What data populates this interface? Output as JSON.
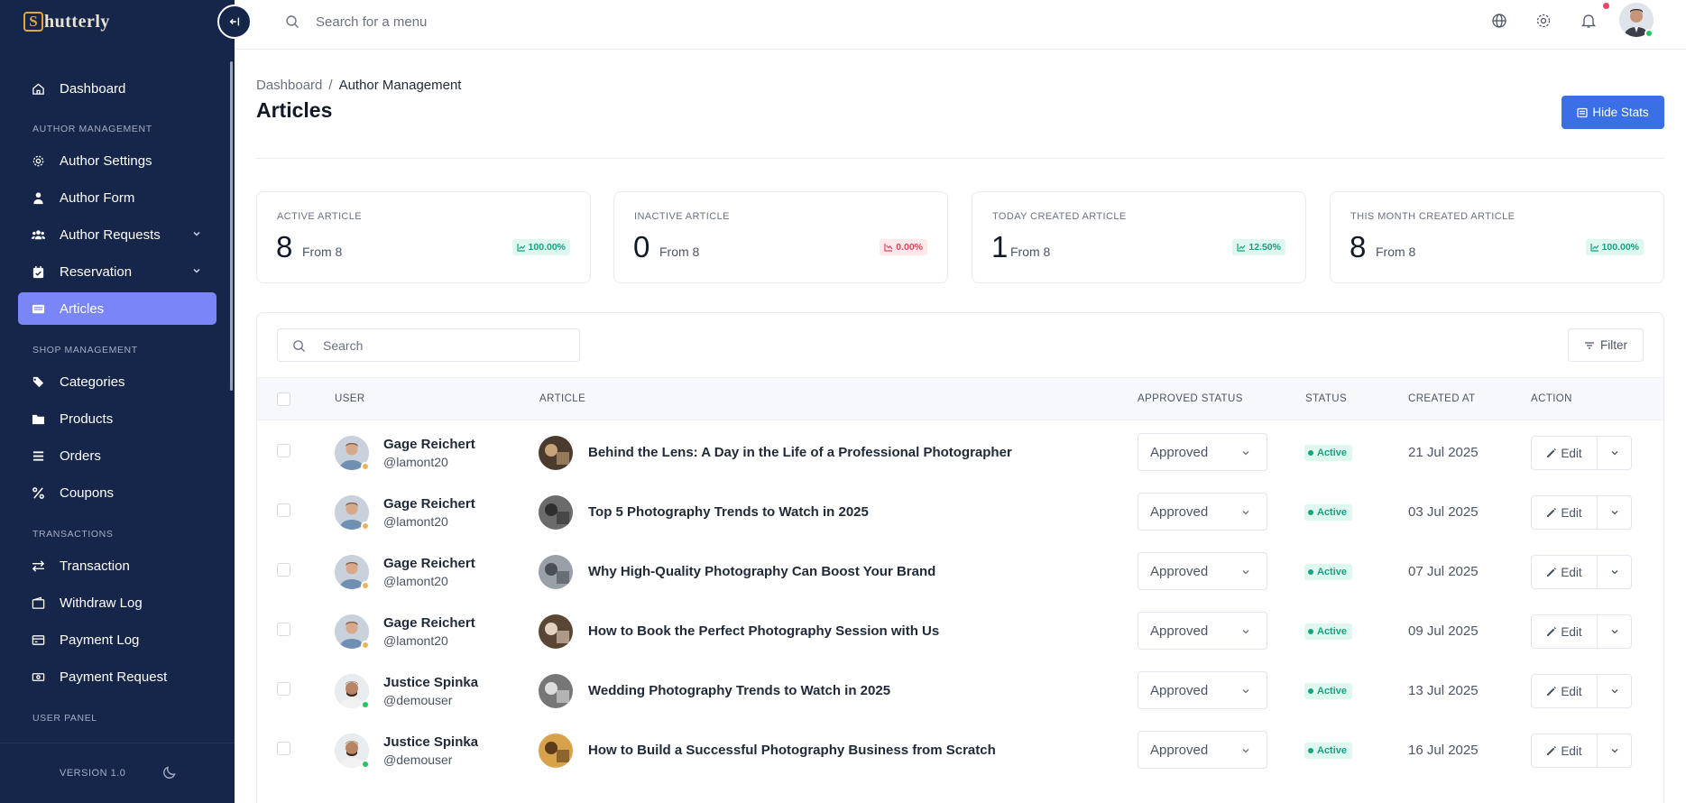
{
  "brand": {
    "logo_letter": "S",
    "logo_text": "hutterly"
  },
  "sidebar": {
    "items": [
      {
        "label": "Dashboard",
        "icon": "home-icon"
      },
      {
        "label": "Author Settings",
        "icon": "gear-icon"
      },
      {
        "label": "Author Form",
        "icon": "user-icon"
      },
      {
        "label": "Author Requests",
        "icon": "users-icon",
        "expandable": true
      },
      {
        "label": "Reservation",
        "icon": "calendar-check-icon",
        "expandable": true
      },
      {
        "label": "Articles",
        "icon": "article-icon",
        "active": true
      },
      {
        "label": "Categories",
        "icon": "tags-icon"
      },
      {
        "label": "Products",
        "icon": "folder-icon"
      },
      {
        "label": "Orders",
        "icon": "list-icon"
      },
      {
        "label": "Coupons",
        "icon": "percent-icon"
      },
      {
        "label": "Transaction",
        "icon": "arrows-exchange-icon"
      },
      {
        "label": "Withdraw Log",
        "icon": "wallet-icon"
      },
      {
        "label": "Payment Log",
        "icon": "credit-card-icon"
      },
      {
        "label": "Payment Request",
        "icon": "money-icon"
      }
    ],
    "sections": [
      "AUTHOR MANAGEMENT",
      "SHOP MANAGEMENT",
      "TRANSACTIONS",
      "USER PANEL"
    ],
    "version": "VERSION 1.0"
  },
  "topbar": {
    "search_placeholder": "Search for a menu"
  },
  "breadcrumb": {
    "root": "Dashboard",
    "separator": "/",
    "current": "Author Management"
  },
  "page": {
    "title": "Articles",
    "hide_stats_label": "Hide Stats"
  },
  "stats": [
    {
      "label": "ACTIVE ARTICLE",
      "value": "8",
      "from": "From 8",
      "change": "100.00%",
      "trend": "up"
    },
    {
      "label": "INACTIVE ARTICLE",
      "value": "0",
      "from": "From 8",
      "change": "0.00%",
      "trend": "down"
    },
    {
      "label": "TODAY CREATED ARTICLE",
      "value": "1",
      "from": "From 8",
      "change": "12.50%",
      "trend": "up"
    },
    {
      "label": "THIS MONTH CREATED ARTICLE",
      "value": "8",
      "from": "From 8",
      "change": "100.00%",
      "trend": "up"
    }
  ],
  "table": {
    "search_placeholder": "Search",
    "filter_label": "Filter",
    "headers": [
      "USER",
      "ARTICLE",
      "APPROVED STATUS",
      "STATUS",
      "CREATED AT",
      "ACTION"
    ],
    "rows": [
      {
        "user": "Gage Reichert",
        "handle": "@lamont20",
        "article": "Behind the Lens: A Day in the Life of a Professional Photographer",
        "approved": "Approved",
        "status": "Active",
        "created": "21 Jul 2025",
        "edit": "Edit",
        "user_dot": "#f0b35a"
      },
      {
        "user": "Gage Reichert",
        "handle": "@lamont20",
        "article": "Top 5 Photography Trends to Watch in 2025",
        "approved": "Approved",
        "status": "Active",
        "created": "03 Jul 2025",
        "edit": "Edit",
        "user_dot": "#f0b35a"
      },
      {
        "user": "Gage Reichert",
        "handle": "@lamont20",
        "article": "Why High-Quality Photography Can Boost Your Brand",
        "approved": "Approved",
        "status": "Active",
        "created": "07 Jul 2025",
        "edit": "Edit",
        "user_dot": "#f0b35a"
      },
      {
        "user": "Gage Reichert",
        "handle": "@lamont20",
        "article": "How to Book the Perfect Photography Session with Us",
        "approved": "Approved",
        "status": "Active",
        "created": "09 Jul 2025",
        "edit": "Edit",
        "user_dot": "#f0b35a"
      },
      {
        "user": "Justice Spinka",
        "handle": "@demouser",
        "article": "Wedding Photography Trends to Watch in 2025",
        "approved": "Approved",
        "status": "Active",
        "created": "13 Jul 2025",
        "edit": "Edit",
        "user_dot": "#22c55e"
      },
      {
        "user": "Justice Spinka",
        "handle": "@demouser",
        "article": "How to Build a Successful Photography Business from Scratch",
        "approved": "Approved",
        "status": "Active",
        "created": "16 Jul 2025",
        "edit": "Edit",
        "user_dot": "#22c55e"
      }
    ]
  },
  "colors": {
    "sidebar_bg": "#16254a",
    "active_nav": "#7a86f5",
    "primary": "#3b6fe6",
    "success": "#16a37f",
    "danger": "#e8415d"
  }
}
